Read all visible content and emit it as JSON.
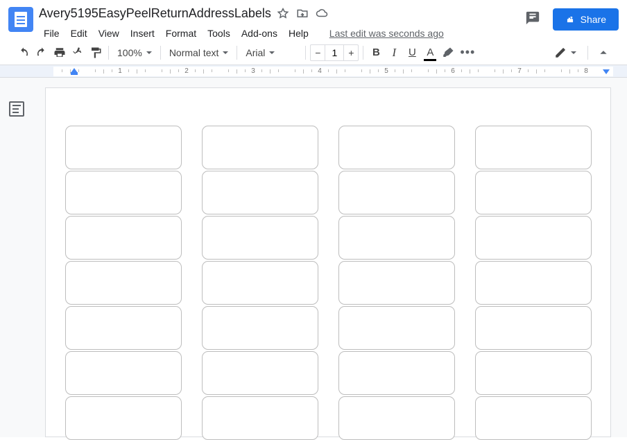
{
  "header": {
    "title": "Avery5195EasyPeelReturnAddressLabels",
    "last_edit": "Last edit was seconds ago",
    "share_label": "Share"
  },
  "menu": {
    "items": [
      "File",
      "Edit",
      "View",
      "Insert",
      "Format",
      "Tools",
      "Add-ons",
      "Help"
    ]
  },
  "toolbar": {
    "zoom": "100%",
    "style": "Normal text",
    "font": "Arial",
    "font_size": "1"
  },
  "ruler": {
    "numbers": [
      1,
      2,
      3,
      4,
      5,
      6,
      7,
      8
    ]
  },
  "labels": {
    "rows": 7,
    "cols": 4
  }
}
